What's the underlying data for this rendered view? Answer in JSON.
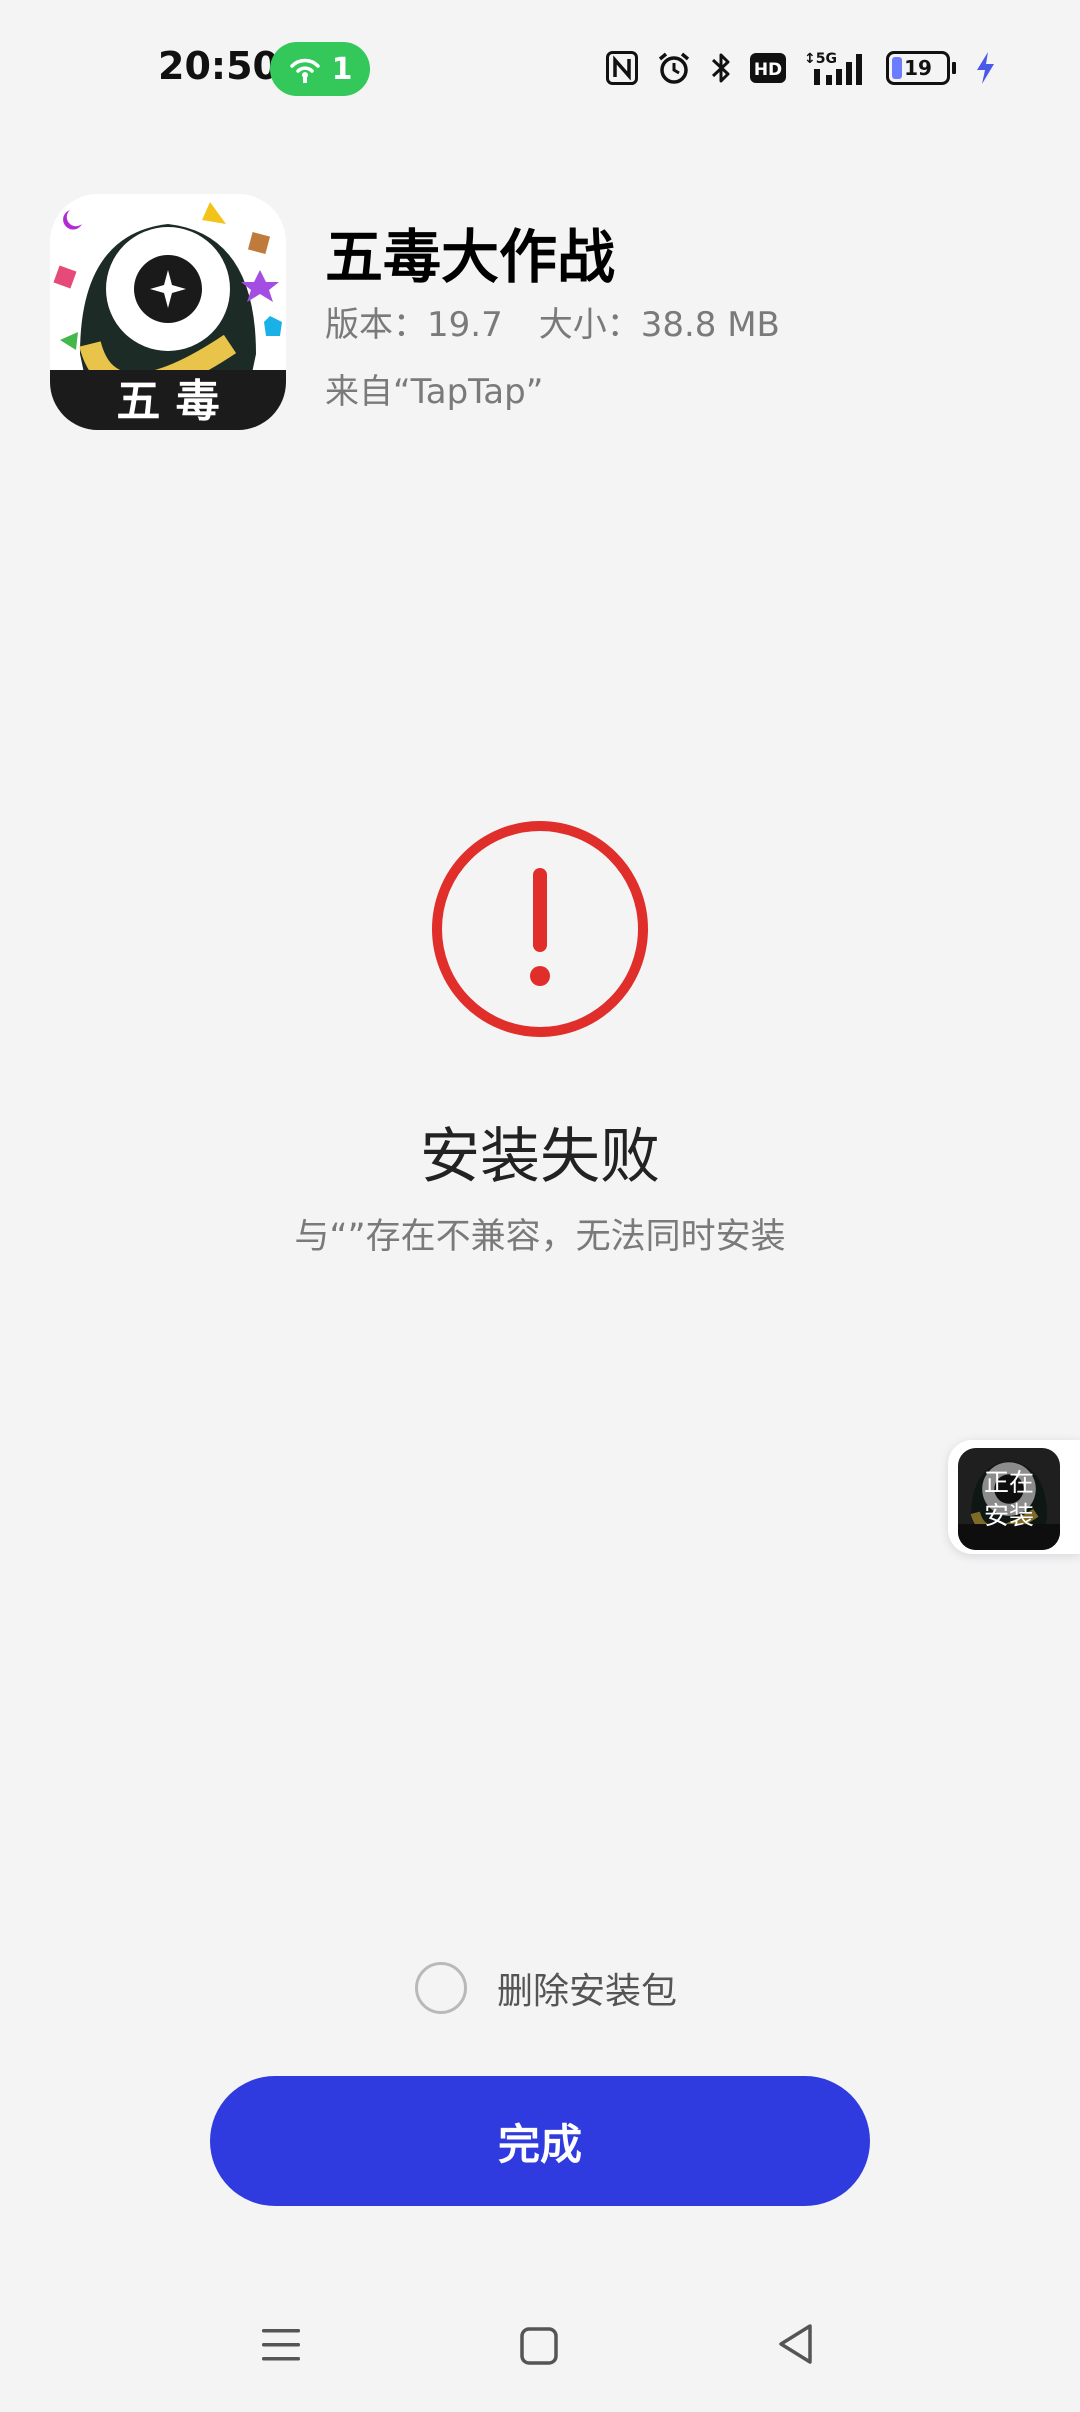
{
  "status_bar": {
    "time": "20:50",
    "hotspot_count": "1",
    "battery_level": "19",
    "icons": [
      "nfc-icon",
      "alarm-icon",
      "bluetooth-icon",
      "hd-icon",
      "signal-5g-icon",
      "battery-icon",
      "charging-icon"
    ]
  },
  "app": {
    "name": "五毒大作战",
    "icon_text": "五 毒",
    "version": "版本：19.7",
    "size": "大小：38.8 MB",
    "source": "来自“TapTap”"
  },
  "result": {
    "title": "安装失败",
    "description": "与“”存在不兼容，无法同时安装"
  },
  "float_bubble": {
    "line1": "正在",
    "line2": "安装"
  },
  "options": {
    "delete_package_label": "删除安装包",
    "delete_package_checked": false
  },
  "actions": {
    "done_label": "完成"
  },
  "colors": {
    "accent": "#2f3bde",
    "error": "#e02e2a",
    "hotspot": "#34c759",
    "background": "#f4f4f5"
  }
}
